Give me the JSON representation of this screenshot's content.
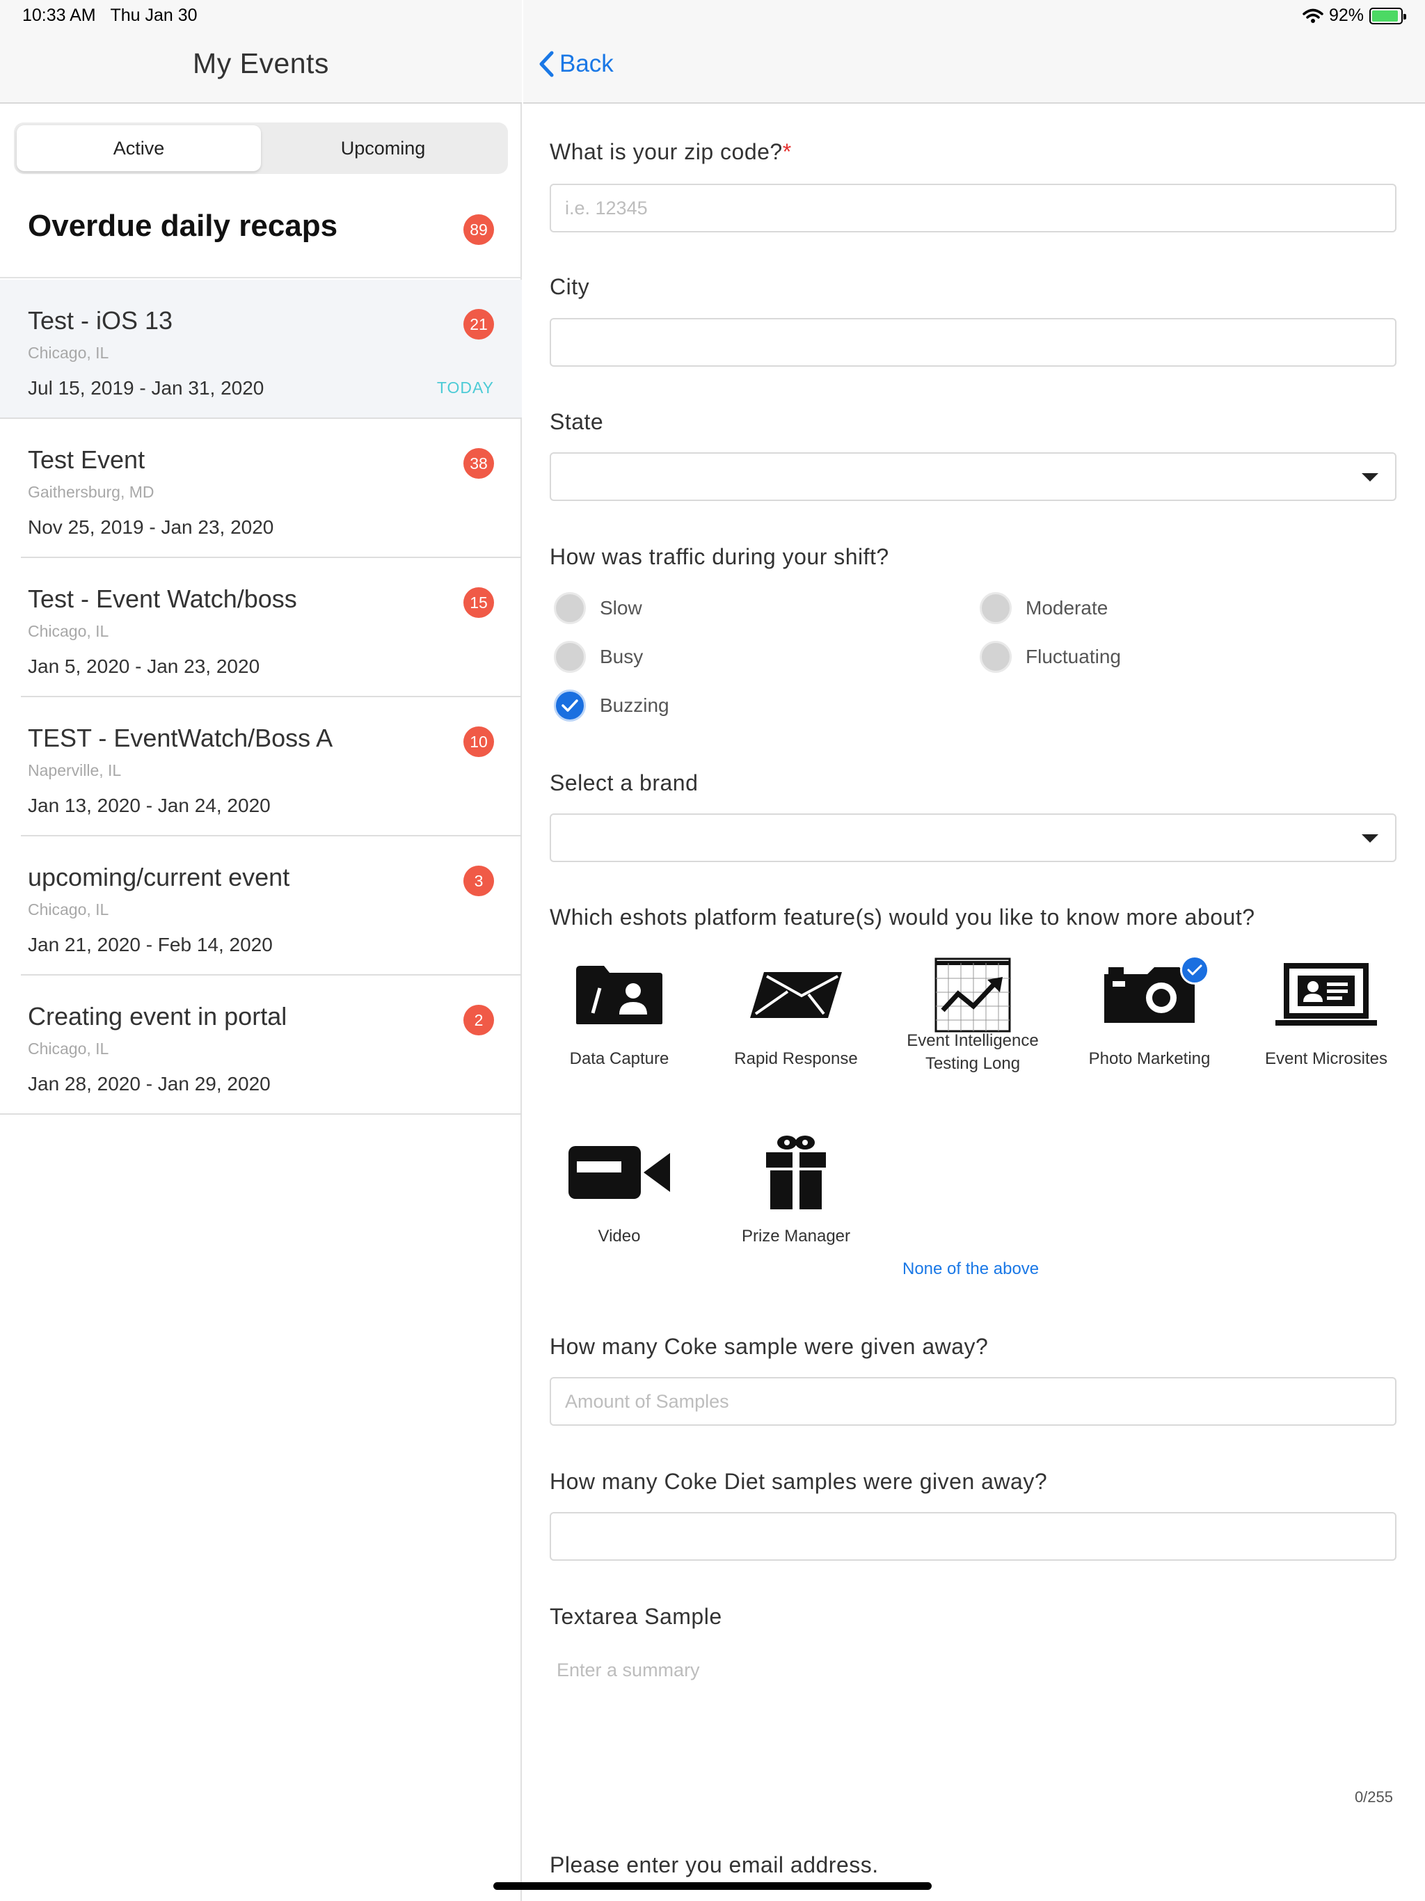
{
  "status_bar": {
    "time": "10:33 AM",
    "date": "Thu Jan 30",
    "battery": "92%"
  },
  "left": {
    "title": "My Events",
    "segments": [
      "Active",
      "Upcoming"
    ],
    "overdue": {
      "title": "Overdue daily recaps",
      "count": "89"
    },
    "events": [
      {
        "name": "Test - iOS 13",
        "location": "Chicago, IL",
        "dates": "Jul 15, 2019 - Jan 31, 2020",
        "count": "21",
        "tag": "TODAY"
      },
      {
        "name": "Test Event",
        "location": "Gaithersburg, MD",
        "dates": "Nov 25, 2019 - Jan 23, 2020",
        "count": "38"
      },
      {
        "name": "Test - Event Watch/boss",
        "location": "Chicago, IL",
        "dates": "Jan 5, 2020 - Jan 23, 2020",
        "count": "15"
      },
      {
        "name": "TEST - EventWatch/Boss A",
        "location": "Naperville, IL",
        "dates": "Jan 13, 2020 - Jan 24, 2020",
        "count": "10"
      },
      {
        "name": "upcoming/current event",
        "location": "Chicago, IL",
        "dates": "Jan 21, 2020 - Feb 14, 2020",
        "count": "3"
      },
      {
        "name": "Creating event in portal",
        "location": "Chicago, IL",
        "dates": "Jan 28, 2020 - Jan 29, 2020",
        "count": "2"
      }
    ]
  },
  "right": {
    "back_label": "Back",
    "zip": {
      "label": "What is your zip code?",
      "required_mark": "*",
      "placeholder": "i.e. 12345"
    },
    "city": {
      "label": "City",
      "value": ""
    },
    "state": {
      "label": "State",
      "value": ""
    },
    "traffic": {
      "label": "How was traffic during your shift?",
      "options": [
        "Slow",
        "Moderate",
        "Busy",
        "Fluctuating",
        "Buzzing"
      ],
      "selected": "Buzzing"
    },
    "brand": {
      "label": "Select a brand",
      "value": ""
    },
    "features": {
      "label": "Which eshots platform feature(s) would you like to know more about?",
      "items": [
        {
          "label": "Data Capture",
          "icon": "data-capture-icon",
          "selected": false
        },
        {
          "label": "Rapid Response",
          "icon": "envelope-icon",
          "selected": false
        },
        {
          "label": "Event Intelligence Testing Long",
          "icon": "chart-icon",
          "selected": false
        },
        {
          "label": "Photo Marketing",
          "icon": "camera-icon",
          "selected": true
        },
        {
          "label": "Event Microsites",
          "icon": "laptop-icon",
          "selected": false
        },
        {
          "label": "Video",
          "icon": "video-camera-icon",
          "selected": false
        },
        {
          "label": "Prize Manager",
          "icon": "gift-icon",
          "selected": false
        }
      ],
      "none_label": "None of the above"
    },
    "coke": {
      "label": "How many Coke sample were given away?",
      "placeholder": "Amount of Samples"
    },
    "diet": {
      "label": "How many Coke Diet samples were given away?",
      "value": ""
    },
    "textarea": {
      "label": "Textarea Sample",
      "placeholder": "Enter a summary",
      "counter": "0/255"
    },
    "email": {
      "label": "Please enter you email address."
    }
  },
  "colors": {
    "accent": "#1a78e6",
    "badge": "#f05a47",
    "today": "#4dcbd6",
    "required": "#e5312f"
  }
}
